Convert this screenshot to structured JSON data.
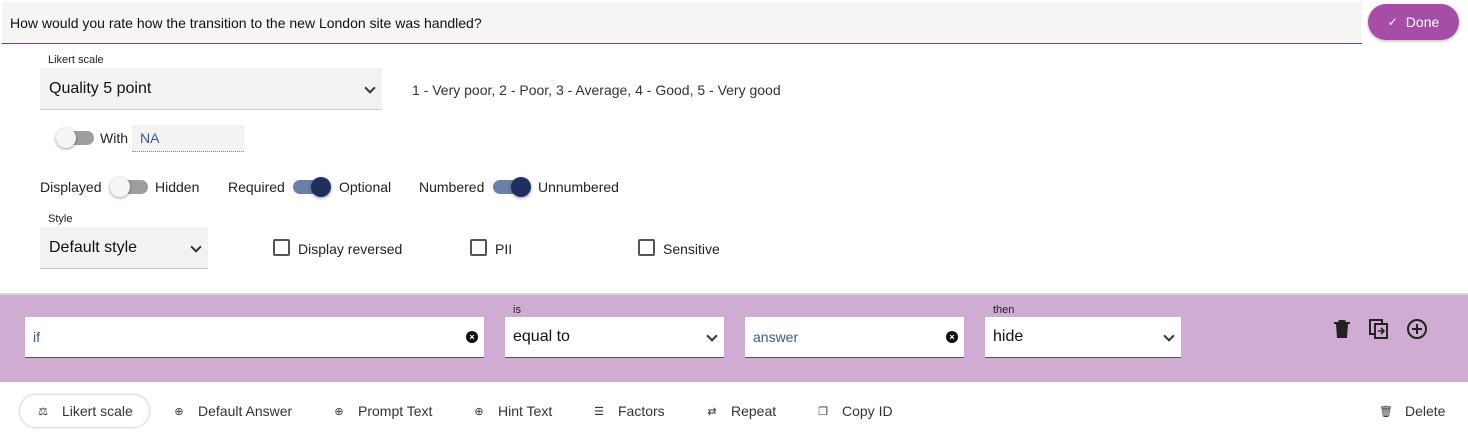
{
  "question": {
    "text": "How would you rate how the transition to the new London site was handled?"
  },
  "done_button": {
    "label": "Done",
    "icon": "check-icon"
  },
  "likert": {
    "label": "Likert scale",
    "selected": "Quality 5 point",
    "description": "1 - Very poor, 2 - Poor, 3 - Average, 4 - Good, 5 - Very good"
  },
  "with_na": {
    "label": "With",
    "value": "NA",
    "enabled": false
  },
  "toggles": {
    "displayed_label": "Displayed",
    "hidden_label": "Hidden",
    "displayed_state": "off",
    "required_label": "Required",
    "optional_label": "Optional",
    "required_state": "on",
    "numbered_label": "Numbered",
    "unnumbered_label": "Unnumbered",
    "numbered_state": "on"
  },
  "style": {
    "label": "Style",
    "selected": "Default style"
  },
  "checkboxes": {
    "display_reversed": "Display reversed",
    "pii": "PII",
    "sensitive": "Sensitive"
  },
  "rule": {
    "if_placeholder": "if",
    "is_label": "is",
    "is_selected": "equal to",
    "answer_placeholder": "answer",
    "then_label": "then",
    "then_selected": "hide",
    "icons": [
      "delete-icon",
      "copy-icon",
      "add-circle-icon"
    ]
  },
  "footer": {
    "likert_scale": "Likert scale",
    "default_answer": "Default Answer",
    "prompt_text": "Prompt Text",
    "hint_text": "Hint Text",
    "factors": "Factors",
    "repeat": "Repeat",
    "copy_id": "Copy ID",
    "delete": "Delete"
  },
  "colors": {
    "accent": "#a64da8",
    "rule_row_bg": "#cfadd3",
    "toggle_on": "#1e3060"
  }
}
